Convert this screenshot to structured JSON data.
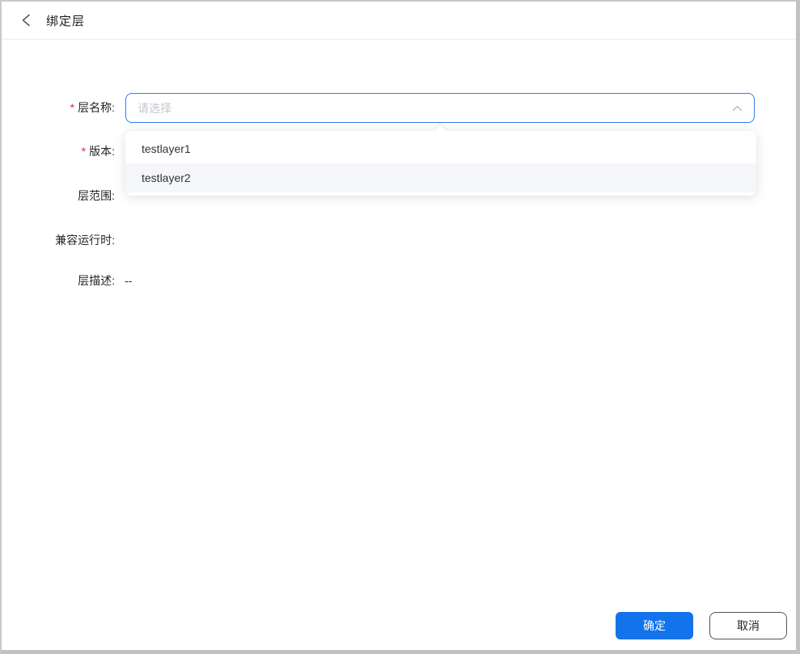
{
  "header": {
    "title": "绑定层"
  },
  "form": {
    "layer_name": {
      "label": "层名称:",
      "required_mark": "*",
      "placeholder": "请选择"
    },
    "version": {
      "label": "版本:",
      "required_mark": "*"
    },
    "layer_scope": {
      "label": "层范围:"
    },
    "compatible_runtime": {
      "label": "兼容运行时:"
    },
    "layer_description": {
      "label": "层描述:",
      "value": "--"
    }
  },
  "dropdown": {
    "options": [
      {
        "label": "testlayer1"
      },
      {
        "label": "testlayer2"
      }
    ]
  },
  "footer": {
    "ok_label": "确定",
    "cancel_label": "取消"
  },
  "colors": {
    "primary": "#1373ec",
    "select_border_focus": "#2f7bf5",
    "required": "#f5222d",
    "dropdown_hover_bg": "#f4f6f9"
  }
}
